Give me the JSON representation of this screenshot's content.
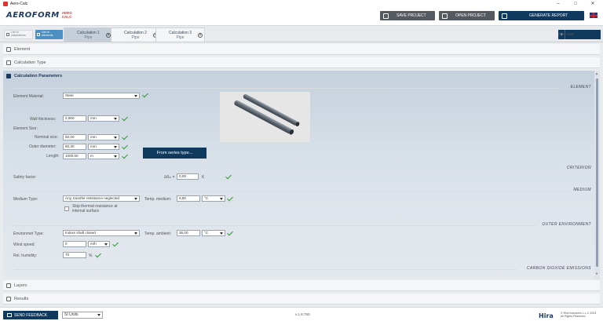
{
  "window": {
    "title": "Aero-Calc",
    "controls": [
      "–",
      "□",
      "✕"
    ]
  },
  "header": {
    "logo_main": "AEROFORM",
    "logo_sub_top": "AERO",
    "logo_sub_bottom": "CALC",
    "save_label": "SAVE PROJECT",
    "open_label": "OPEN PROJECT",
    "report_label": "GENERATE REPORT"
  },
  "tabs": {
    "list_light_line1": "List of",
    "list_light_line2": "calculations",
    "list_dark_line1": "List of",
    "list_dark_line2": "elements",
    "calcs": [
      {
        "name": "Calculation 1",
        "sub": "Pipe"
      },
      {
        "name": "Calculation 2",
        "sub": "Pipe"
      },
      {
        "name": "Calculation 3",
        "sub": "Pipe"
      }
    ],
    "add_new": "Add new"
  },
  "sections": {
    "element": "Element",
    "calc_type": "Calculation Type",
    "calc_params": "Calculation Parameters",
    "layers": "Layers",
    "results": "Results"
  },
  "groups": {
    "element": "ELEMENT",
    "criterion": "CRITERION",
    "medium": "MEDIUM",
    "outer_env": "OUTER ENVIRONMENT",
    "co2": "CARBON DIOXIDE EMISSIONS"
  },
  "form": {
    "element_material_label": "Element Material:",
    "element_material_value": "Steel",
    "wall_thickness_label": "Wall thickness:",
    "wall_thickness_value": "2,900",
    "wall_thickness_unit": "mm",
    "element_size_label": "Element Size:",
    "nominal_size_label": "Nominal size:",
    "nominal_size_value": "50,00",
    "nominal_size_unit": "mm",
    "outer_diameter_label": "Outer diameter:",
    "outer_diameter_value": "60,30",
    "outer_diameter_unit": "mm",
    "length_label": "Length:",
    "length_value": "1000,00",
    "length_unit": "m",
    "series_button": "From series type...",
    "safety_factor_label": "Safety factor:",
    "delta_label": "Δθₘ =",
    "delta_value": "0,00",
    "delta_unit": "K",
    "medium_type_label": "Medium Type:",
    "medium_type_value": "Any, transfer resistance neglected",
    "temp_medium_label": "Temp. medium:",
    "temp_medium_value": "5,50",
    "temp_medium_unit": "°C",
    "skip_line1": "Skip thermal resistance at",
    "skip_line2": "internal surface",
    "env_type_label": "Environmet Type:",
    "env_type_value": "Indoor shaft closed",
    "temp_ambient_label": "Temp. ambient:",
    "temp_ambient_value": "36,00",
    "temp_ambient_unit": "°C",
    "wind_speed_label": "Wind speed:",
    "wind_speed_value": "0",
    "wind_speed_unit": "m/h",
    "rel_humidity_label": "Rel. humidity:",
    "rel_humidity_value": "70",
    "rel_humidity_unit": "%"
  },
  "footer": {
    "feedback": "SEND FEEDBACK",
    "units": "SI Units",
    "version": "v.1.8.750",
    "brand": "Hira",
    "copy_line1": "© Hira Industries L.L.C 2024",
    "copy_line2": "All Rights Reserved"
  }
}
